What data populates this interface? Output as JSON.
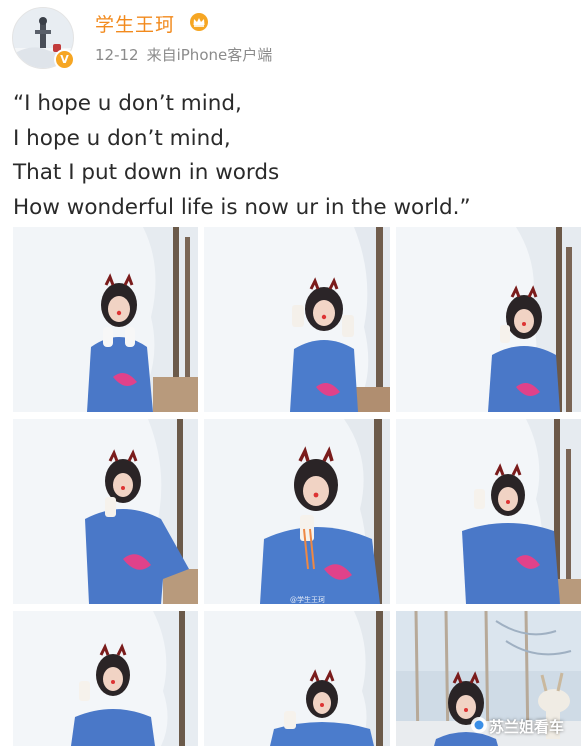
{
  "header": {
    "username": "学生王珂",
    "date": "12-12",
    "source": "来自iPhone客户端",
    "verified_badge": "V",
    "crown_icon": "crown-icon",
    "accent_color": "#f28a1d"
  },
  "post": {
    "lines": [
      "“I hope u don’t mind,",
      "I hope u don’t mind,",
      "That I put down in words",
      "How wonderful life is now ur in the world.”"
    ]
  },
  "photos": {
    "count": 9,
    "tile_5_caption": "@学生王珂",
    "watermark": "苏兰姐看车"
  }
}
